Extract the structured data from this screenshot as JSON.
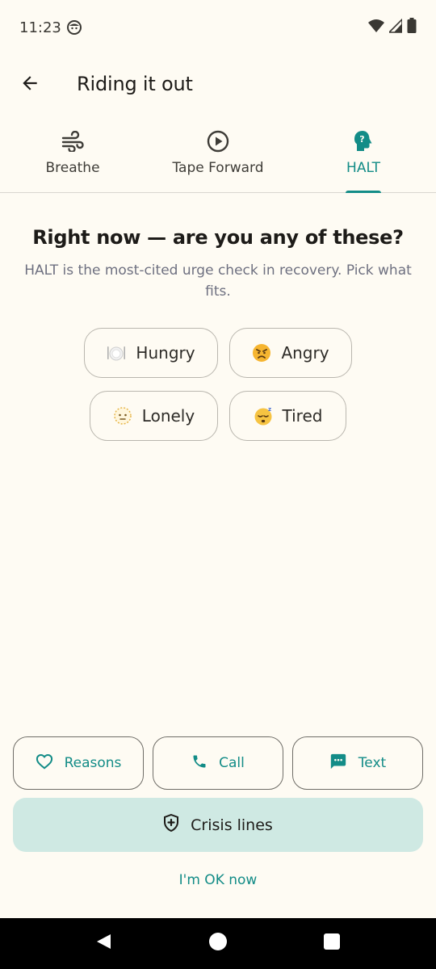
{
  "status_bar": {
    "time": "11:23"
  },
  "app_bar": {
    "title": "Riding it out"
  },
  "tabs": [
    {
      "label": "Breathe",
      "icon": "wind-icon"
    },
    {
      "label": "Tape Forward",
      "icon": "play-circle-icon"
    },
    {
      "label": "HALT",
      "icon": "head-question-icon",
      "active": true
    }
  ],
  "halt": {
    "question": "Right now — are you any of these?",
    "subtitle": "HALT is the most-cited urge check in recovery. Pick what fits.",
    "options": [
      {
        "label": "Hungry",
        "emoji": "plate-icon"
      },
      {
        "label": "Angry",
        "emoji": "angry-face-icon"
      },
      {
        "label": "Lonely",
        "emoji": "dotted-face-icon"
      },
      {
        "label": "Tired",
        "emoji": "sleeping-face-icon"
      }
    ]
  },
  "actions": {
    "reasons": "Reasons",
    "call": "Call",
    "text": "Text",
    "crisis_lines": "Crisis lines",
    "ok_now": "I'm OK now"
  },
  "colors": {
    "accent": "#138C87",
    "background": "#FEFBF3",
    "crisis_bg": "#CFE9E3"
  }
}
